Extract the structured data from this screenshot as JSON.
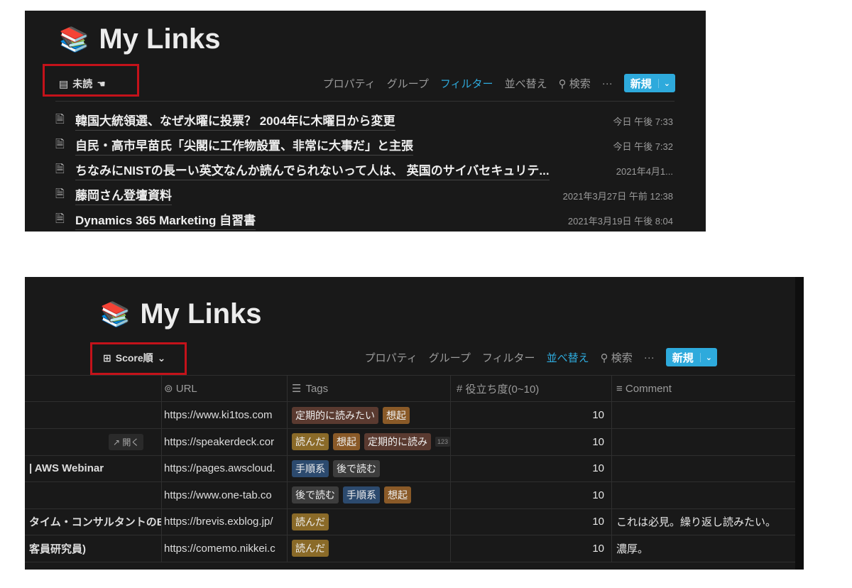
{
  "colors": {
    "accent": "#2eaadc",
    "highlight_box": "#c4121a",
    "background": "#191919"
  },
  "top": {
    "title": "My Links",
    "title_icon": "books-emoji",
    "view": {
      "label": "未読",
      "icon": "document-list-icon"
    },
    "toolbar": {
      "properties": "プロパティ",
      "group": "グループ",
      "filter": "フィルター",
      "sort": "並べ替え",
      "search": "検索",
      "more": "···",
      "new": "新規",
      "new_chevron": "⌄"
    },
    "active_tool": "filter",
    "rows": [
      {
        "title": "韓国大統領選、なぜ水曜に投票？ 2004年に木曜日から変更",
        "date": "今日 午後 7:33"
      },
      {
        "title": "自民・高市早苗氏「尖閣に工作物設置、非常に大事だ」と主張",
        "date": "今日 午後 7:32"
      },
      {
        "title": "ちなみにNISTの長ーい英文なんか読んでられないって人は、 英国のサイバセキュリテ...",
        "date": "2021年4月1..."
      },
      {
        "title": "藤岡さん登壇資料",
        "date": "2021年3月27日 午前 12:38"
      },
      {
        "title": "Dynamics 365 Marketing 自習書",
        "date": "2021年3月19日 午後 8:04"
      }
    ]
  },
  "bottom": {
    "title": "My Links",
    "title_icon": "books-emoji",
    "view": {
      "label": "Score順",
      "icon": "table-icon",
      "chevron": "⌄"
    },
    "toolbar": {
      "properties": "プロパティ",
      "group": "グループ",
      "filter": "フィルター",
      "sort": "並べ替え",
      "search": "検索",
      "more": "···",
      "new": "新規",
      "new_chevron": "⌄"
    },
    "active_tool": "sort",
    "columns": [
      "",
      "URL",
      "Tags",
      "役立ち度(0~10)",
      "Comment"
    ],
    "column_icons": [
      "",
      "link-icon",
      "multi-select-icon",
      "number-icon",
      "text-icon"
    ],
    "open_label": "↗ 開く",
    "rows": [
      {
        "name": "",
        "url": "https://www.ki1tos.com",
        "tags": [
          {
            "t": "定期的に読みたい",
            "c": "#5a3a30"
          },
          {
            "t": "想起",
            "c": "#8a5a28"
          }
        ],
        "score": "10",
        "comment": ""
      },
      {
        "name": "",
        "url": "https://speakerdeck.cor",
        "tags": [
          {
            "t": "読んだ",
            "c": "#8a6a28"
          },
          {
            "t": "想起",
            "c": "#8a5a28"
          },
          {
            "t": "定期的に読み",
            "c": "#5a3a30"
          }
        ],
        "extra": "123",
        "score": "10",
        "comment": ""
      },
      {
        "name": "| AWS Webinar",
        "url": "https://pages.awscloud.",
        "tags": [
          {
            "t": "手順系",
            "c": "#2c4a6e"
          },
          {
            "t": "後で読む",
            "c": "#3d3d3d"
          }
        ],
        "score": "10",
        "comment": ""
      },
      {
        "name": "",
        "url": "https://www.one-tab.co",
        "tags": [
          {
            "t": "後で読む",
            "c": "#3d3d3d"
          },
          {
            "t": "手順系",
            "c": "#2c4a6e"
          },
          {
            "t": "想起",
            "c": "#8a5a28"
          }
        ],
        "score": "10",
        "comment": ""
      },
      {
        "name": "タイム・コンサルタントのE",
        "url": "https://brevis.exblog.jp/",
        "tags": [
          {
            "t": "読んだ",
            "c": "#8a6a28"
          }
        ],
        "score": "10",
        "comment": "これは必見。繰り返し読みたい。"
      },
      {
        "name": "客員研究員)",
        "url": "https://comemo.nikkei.c",
        "tags": [
          {
            "t": "読んだ",
            "c": "#8a6a28"
          }
        ],
        "score": "10",
        "comment": "濃厚。"
      }
    ]
  }
}
